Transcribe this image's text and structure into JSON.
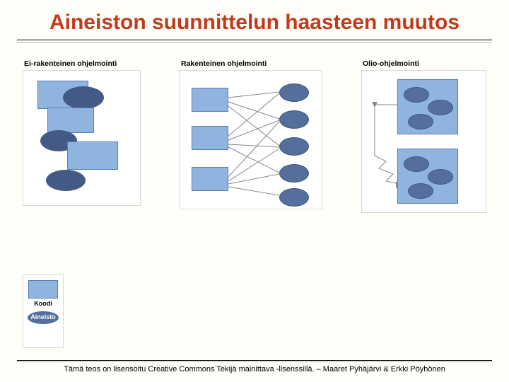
{
  "title": "Aineiston suunnittelun haasteen muutos",
  "panels": [
    {
      "title": "Ei-rakenteinen ohjelmointi"
    },
    {
      "title": "Rakenteinen ohjelmointi"
    },
    {
      "title": "Olio-ohjelmointi"
    }
  ],
  "legend": {
    "code": "Koodi",
    "data": "Aineisto"
  },
  "footer": "Tämä teos on lisensoitu Creative Commons Tekijä mainittava -lisenssillä. – Maaret Pyhäjärvi & Erkki Pöyhönen"
}
